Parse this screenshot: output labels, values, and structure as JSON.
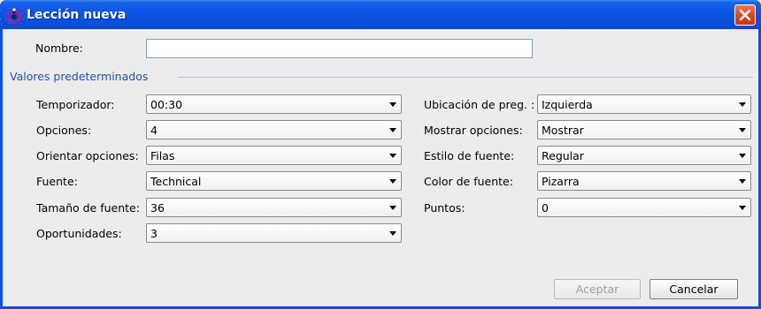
{
  "window": {
    "title": "Lección nueva",
    "icon": "app-logo-icon",
    "close_icon": "close-icon"
  },
  "form": {
    "name_label": "Nombre:",
    "name_value": "",
    "section_title": "Valores predeterminados"
  },
  "left_fields": [
    {
      "label": "Temporizador:",
      "value": "00:30"
    },
    {
      "label": "Opciones:",
      "value": "4"
    },
    {
      "label": "Orientar opciones:",
      "value": "Filas"
    },
    {
      "label": "Fuente:",
      "value": "Technical"
    },
    {
      "label": "Tamaño de fuente:",
      "value": "36"
    },
    {
      "label": "Oportunidades:",
      "value": "3"
    }
  ],
  "right_fields": [
    {
      "label": "Ubicación de preg. :",
      "value": "Izquierda"
    },
    {
      "label": "Mostrar opciones:",
      "value": "Mostrar"
    },
    {
      "label": "Estilo de fuente:",
      "value": "Regular"
    },
    {
      "label": "Color de fuente:",
      "value": "Pizarra"
    },
    {
      "label": "Puntos:",
      "value": "0"
    }
  ],
  "buttons": {
    "accept": "Aceptar",
    "cancel": "Cancelar"
  }
}
